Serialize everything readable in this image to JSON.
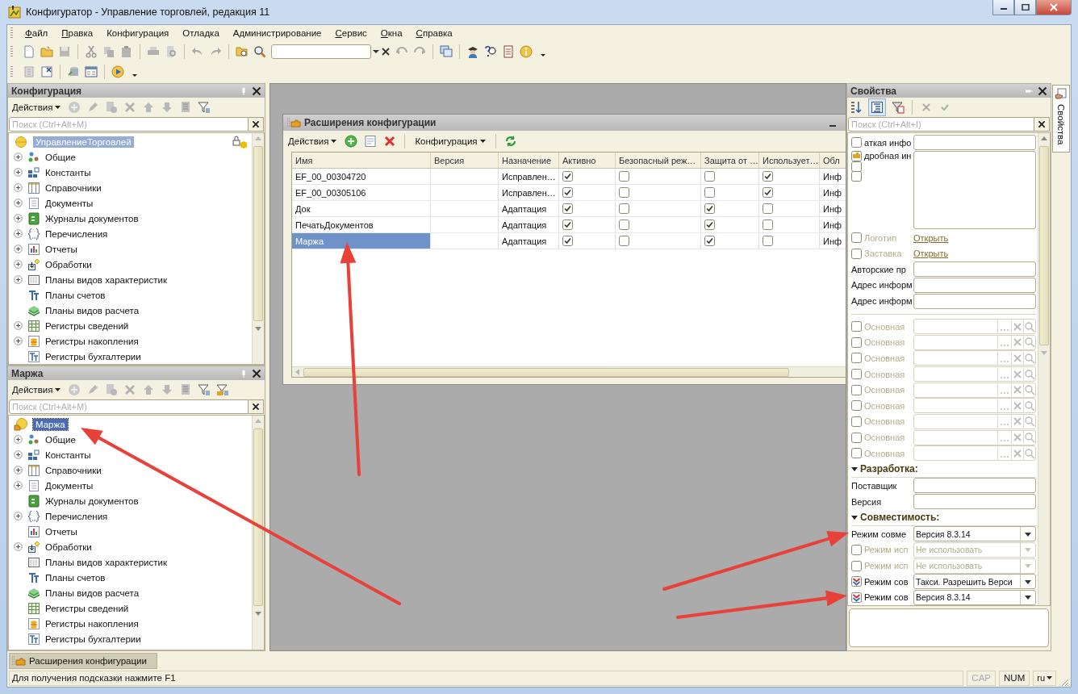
{
  "window": {
    "title": "Конфигуратор - Управление торговлей, редакция 11"
  },
  "menu": [
    {
      "label": "Файл",
      "mnemonic": true
    },
    {
      "label": "Правка",
      "mnemonic": true
    },
    {
      "label": "Конфигурация",
      "mnemonic": false
    },
    {
      "label": "Отладка",
      "mnemonic": false
    },
    {
      "label": "Администрирование",
      "mnemonic": false
    },
    {
      "label": "Сервис",
      "mnemonic": true
    },
    {
      "label": "Окна",
      "mnemonic": true
    },
    {
      "label": "Справка",
      "mnemonic": true
    }
  ],
  "panels": [
    {
      "title": "Конфигурация",
      "actions": "Действия",
      "search_placeholder": "Поиск (Ctrl+Alt+M)",
      "focused": false,
      "root": {
        "label": "УправлениеТорговлей",
        "kind": "configuration",
        "selected": true
      },
      "items": [
        {
          "label": "Общие",
          "kind": "common",
          "expandable": true
        },
        {
          "label": "Константы",
          "kind": "constants",
          "expandable": true
        },
        {
          "label": "Справочники",
          "kind": "catalogs",
          "expandable": true
        },
        {
          "label": "Документы",
          "kind": "documents",
          "expandable": true
        },
        {
          "label": "Журналы документов",
          "kind": "journals",
          "expandable": true
        },
        {
          "label": "Перечисления",
          "kind": "enums",
          "expandable": true
        },
        {
          "label": "Отчеты",
          "kind": "reports",
          "expandable": true
        },
        {
          "label": "Обработки",
          "kind": "processors",
          "expandable": true
        },
        {
          "label": "Планы видов характеристик",
          "kind": "characteristics",
          "expandable": true
        },
        {
          "label": "Планы счетов",
          "kind": "accounts",
          "expandable": false
        },
        {
          "label": "Планы видов расчета",
          "kind": "calculation",
          "expandable": false
        },
        {
          "label": "Регистры сведений",
          "kind": "info_registers",
          "expandable": true
        },
        {
          "label": "Регистры накопления",
          "kind": "accum_registers",
          "expandable": true
        },
        {
          "label": "Регистры бухгалтерии",
          "kind": "accounting_registers",
          "expandable": false
        }
      ]
    },
    {
      "title": "Маржа",
      "actions": "Действия",
      "search_placeholder": "Поиск (Ctrl+Alt+M)",
      "focused": true,
      "root": {
        "label": "Маржа",
        "kind": "extension",
        "selected": true
      },
      "items": [
        {
          "label": "Общие",
          "kind": "common",
          "expandable": true
        },
        {
          "label": "Константы",
          "kind": "constants",
          "expandable": true
        },
        {
          "label": "Справочники",
          "kind": "catalogs",
          "expandable": true
        },
        {
          "label": "Документы",
          "kind": "documents",
          "expandable": true
        },
        {
          "label": "Журналы документов",
          "kind": "journals",
          "expandable": false
        },
        {
          "label": "Перечисления",
          "kind": "enums",
          "expandable": true
        },
        {
          "label": "Отчеты",
          "kind": "reports",
          "expandable": false
        },
        {
          "label": "Обработки",
          "kind": "processors",
          "expandable": true
        },
        {
          "label": "Планы видов характеристик",
          "kind": "characteristics",
          "expandable": false
        },
        {
          "label": "Планы счетов",
          "kind": "accounts",
          "expandable": false
        },
        {
          "label": "Планы видов расчета",
          "kind": "calculation",
          "expandable": false
        },
        {
          "label": "Регистры сведений",
          "kind": "info_registers",
          "expandable": false
        },
        {
          "label": "Регистры накопления",
          "kind": "accum_registers",
          "expandable": false
        },
        {
          "label": "Регистры бухгалтерии",
          "kind": "accounting_registers",
          "expandable": false
        }
      ]
    }
  ],
  "dialog": {
    "title": "Расширения конфигурации",
    "actions": "Действия",
    "config_menu": "Конфигурация",
    "columns": [
      "Имя",
      "Версия",
      "Назначение",
      "Активно",
      "Безопасный реж…",
      "Защита от …",
      "Использует…",
      "Обл"
    ],
    "rows": [
      {
        "name": "EF_00_00304720",
        "purpose": "Исправлен…",
        "active": true,
        "safe_mode": false,
        "protection": false,
        "uses": true,
        "column_8": "Инф",
        "selected": false
      },
      {
        "name": "EF_00_00305106",
        "purpose": "Исправлен…",
        "active": true,
        "safe_mode": false,
        "protection": false,
        "uses": true,
        "column_8": "Инф",
        "selected": false
      },
      {
        "name": "Док",
        "purpose": "Адаптация",
        "active": true,
        "safe_mode": false,
        "protection": true,
        "uses": false,
        "column_8": "Инф",
        "selected": false
      },
      {
        "name": "ПечатьДокументов",
        "purpose": "Адаптация",
        "active": true,
        "safe_mode": false,
        "protection": true,
        "uses": false,
        "column_8": "Инф",
        "selected": false
      },
      {
        "name": "Маржа",
        "purpose": "Адаптация",
        "active": true,
        "safe_mode": false,
        "protection": true,
        "uses": false,
        "column_8": "Инф",
        "selected": true
      }
    ]
  },
  "properties": {
    "title": "Свойства",
    "search_placeholder": "Поиск (Ctrl+Alt+I)",
    "tab": "Свойства",
    "rows": [
      {
        "kind": "text",
        "label": "аткая инфо",
        "checked": false,
        "disabled": false
      },
      {
        "kind": "memo",
        "label": "дробная ин",
        "disabled": false
      },
      {
        "kind": "link",
        "label": "Логотип",
        "link": "Открыть",
        "checked": false,
        "disabled": true
      },
      {
        "kind": "link",
        "label": "Заставка",
        "link": "Открыть",
        "checked": false,
        "disabled": true
      },
      {
        "kind": "text",
        "label": "Авторские пр",
        "disabled": false
      },
      {
        "kind": "text",
        "label": "Адрес информ",
        "disabled": false
      },
      {
        "kind": "text",
        "label": "Адрес информ",
        "disabled": false
      },
      {
        "kind": "separator"
      },
      {
        "kind": "ref",
        "label": "Основная",
        "checked": false,
        "disabled": true
      },
      {
        "kind": "ref",
        "label": "Основная",
        "checked": false,
        "disabled": true
      },
      {
        "kind": "ref",
        "label": "Основная",
        "checked": false,
        "disabled": true
      },
      {
        "kind": "ref",
        "label": "Основная",
        "checked": false,
        "disabled": true
      },
      {
        "kind": "ref",
        "label": "Основная",
        "checked": false,
        "disabled": true
      },
      {
        "kind": "ref",
        "label": "Основная",
        "checked": false,
        "disabled": true
      },
      {
        "kind": "ref",
        "label": "Основная",
        "checked": false,
        "disabled": true
      },
      {
        "kind": "ref",
        "label": "Основная",
        "checked": false,
        "disabled": true
      },
      {
        "kind": "ref",
        "label": "Основная",
        "checked": false,
        "disabled": true
      },
      {
        "kind": "section",
        "label": "Разработка:",
        "expanded": true
      },
      {
        "kind": "text",
        "label": "Поставщик",
        "disabled": false
      },
      {
        "kind": "text",
        "label": "Версия",
        "disabled": false
      },
      {
        "kind": "section",
        "label": "Совместимость:",
        "expanded": true
      },
      {
        "kind": "select",
        "label": "Режим совме",
        "value": "Версия 8.3.14",
        "disabled": false
      },
      {
        "kind": "select",
        "label": "Режим исп",
        "value": "Не использовать",
        "checked": false,
        "disabled": true
      },
      {
        "kind": "select",
        "label": "Режим исп",
        "value": "Не использовать",
        "checked": false,
        "disabled": true
      },
      {
        "kind": "select",
        "label": "Режим сов",
        "value": "Такси. Разрешить Верси",
        "checked": true,
        "disabled": false
      },
      {
        "kind": "select",
        "label": "Режим сов",
        "value": "Версия 8.3.14",
        "checked": true,
        "disabled": false
      }
    ]
  },
  "window_tabs": [
    {
      "label": "Расширения конфигурации",
      "selected": true
    }
  ],
  "status_bar": {
    "hint": "Для получения подсказки нажмите F1",
    "indicators": [
      {
        "label": "CAP",
        "on": false
      },
      {
        "label": "NUM",
        "on": true
      }
    ],
    "language": "ru"
  }
}
